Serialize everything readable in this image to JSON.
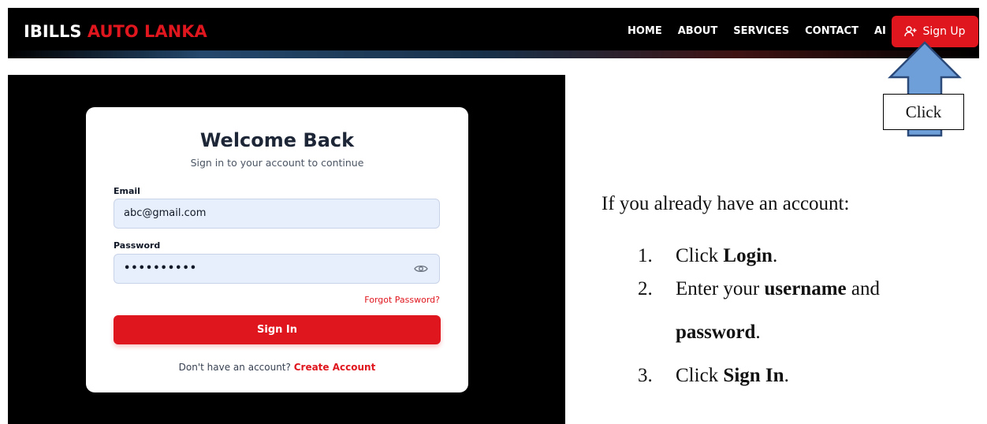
{
  "navbar": {
    "brand_part1": "IBILLS",
    "brand_part2": "AUTO LANKA",
    "links": [
      "HOME",
      "ABOUT",
      "SERVICES",
      "CONTACT",
      "AI"
    ],
    "signup_label": "Sign Up"
  },
  "login": {
    "title": "Welcome Back",
    "subtitle": "Sign in to your account to continue",
    "email_label": "Email",
    "email_value": "abc@gmail.com",
    "password_label": "Password",
    "password_value": "••••••••••",
    "forgot_label": "Forgot Password?",
    "signin_label": "Sign In",
    "no_account_text": "Don't have an account?",
    "create_account_label": "Create Account"
  },
  "callout": {
    "label": "Click"
  },
  "instructions": {
    "intro": "If you already have an account:",
    "steps": [
      {
        "num": "1.",
        "pre": "Click ",
        "bold": "Login",
        "post": "."
      },
      {
        "num": "2.",
        "pre": "Enter your ",
        "bold": "username",
        "post": " and"
      },
      {
        "num": "",
        "pre": "",
        "bold": "password",
        "post": "."
      },
      {
        "num": "3.",
        "pre": "Click ",
        "bold": "Sign In",
        "post": "."
      }
    ]
  },
  "colors": {
    "accent": "#e0161e",
    "arrow_fill": "#6f9fd8",
    "arrow_stroke": "#2b4a7a"
  }
}
